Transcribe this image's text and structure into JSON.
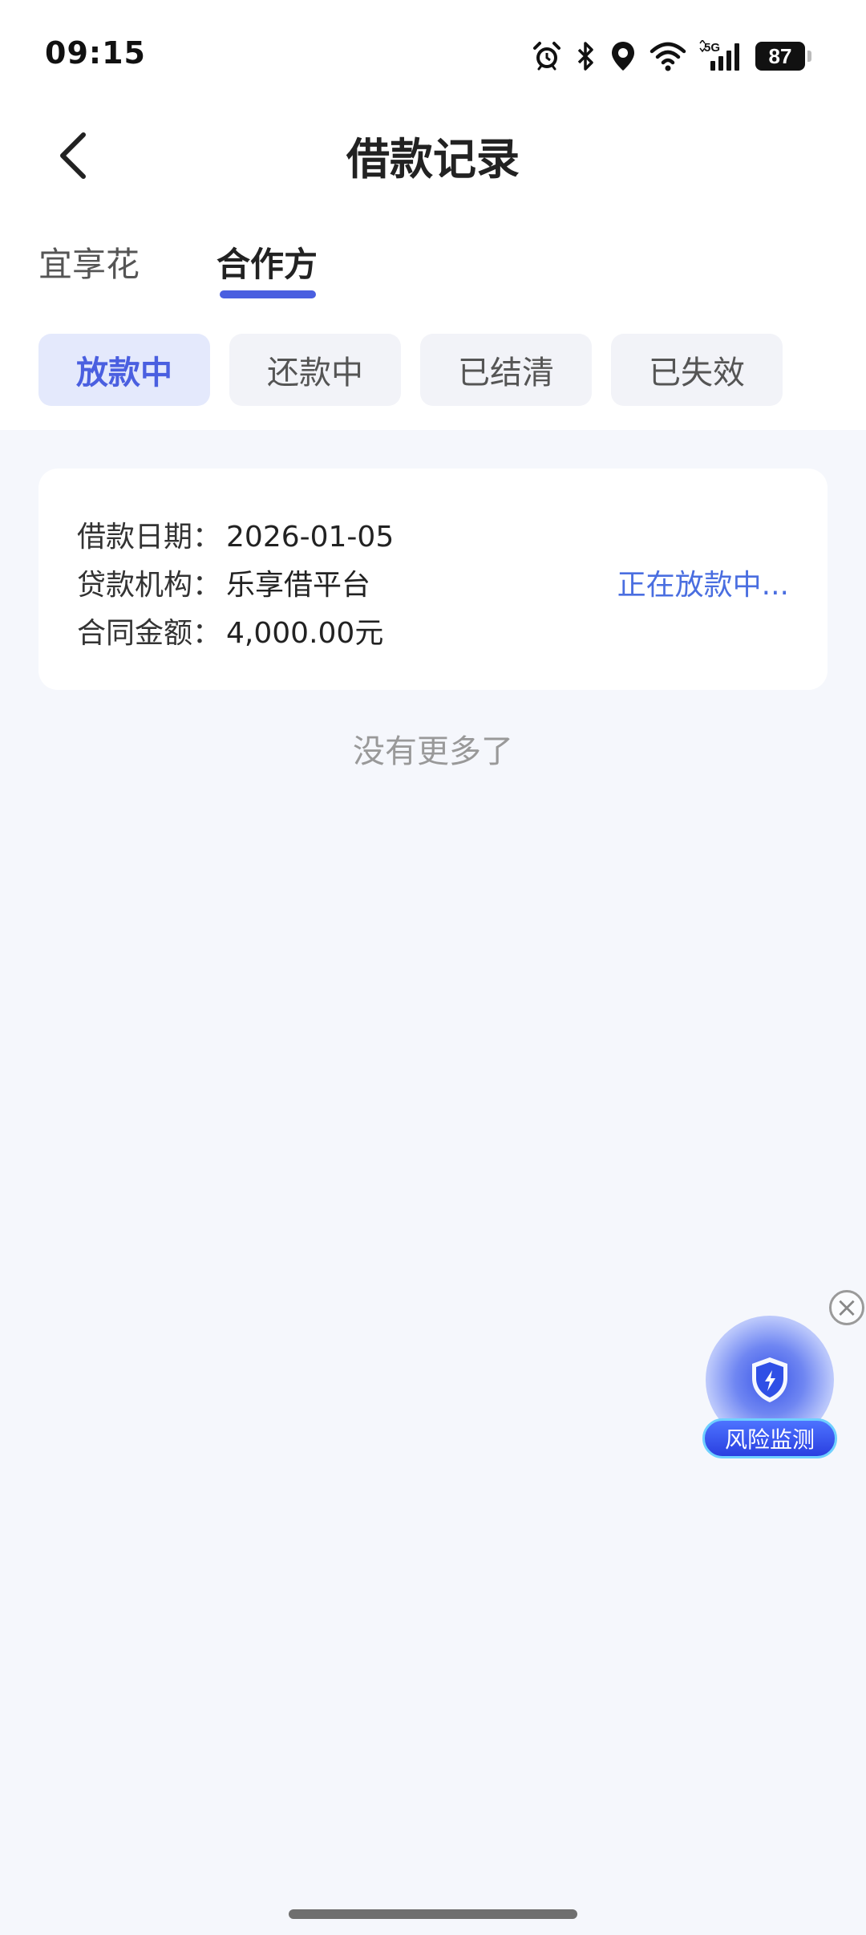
{
  "status_bar": {
    "time": "09:15",
    "network": "5G",
    "battery": "87",
    "icons": [
      "alarm-icon",
      "bluetooth-icon",
      "location-icon",
      "wifi-icon",
      "signal-icon",
      "battery-icon"
    ]
  },
  "header": {
    "title": "借款记录",
    "back_icon": "chevron-left-icon"
  },
  "tabs": [
    {
      "label": "宜享花",
      "active": false
    },
    {
      "label": "合作方",
      "active": true
    }
  ],
  "filters": [
    {
      "label": "放款中",
      "active": true
    },
    {
      "label": "还款中",
      "active": false
    },
    {
      "label": "已结清",
      "active": false
    },
    {
      "label": "已失效",
      "active": false
    }
  ],
  "records": [
    {
      "date_label": "借款日期：",
      "date": "2026-01-05",
      "institution_label": "贷款机构：",
      "institution": "乐享借平台",
      "amount_label": "合同金额：",
      "amount": "4,000.00元",
      "status": "正在放款中..."
    }
  ],
  "list_end_text": "没有更多了",
  "risk_widget": {
    "label": "风险监测",
    "icon": "shield-icon",
    "close_icon": "close-icon"
  },
  "colors": {
    "accent": "#4a5fe0",
    "status_text": "#4a6ee0",
    "background": "#f5f7fc"
  }
}
